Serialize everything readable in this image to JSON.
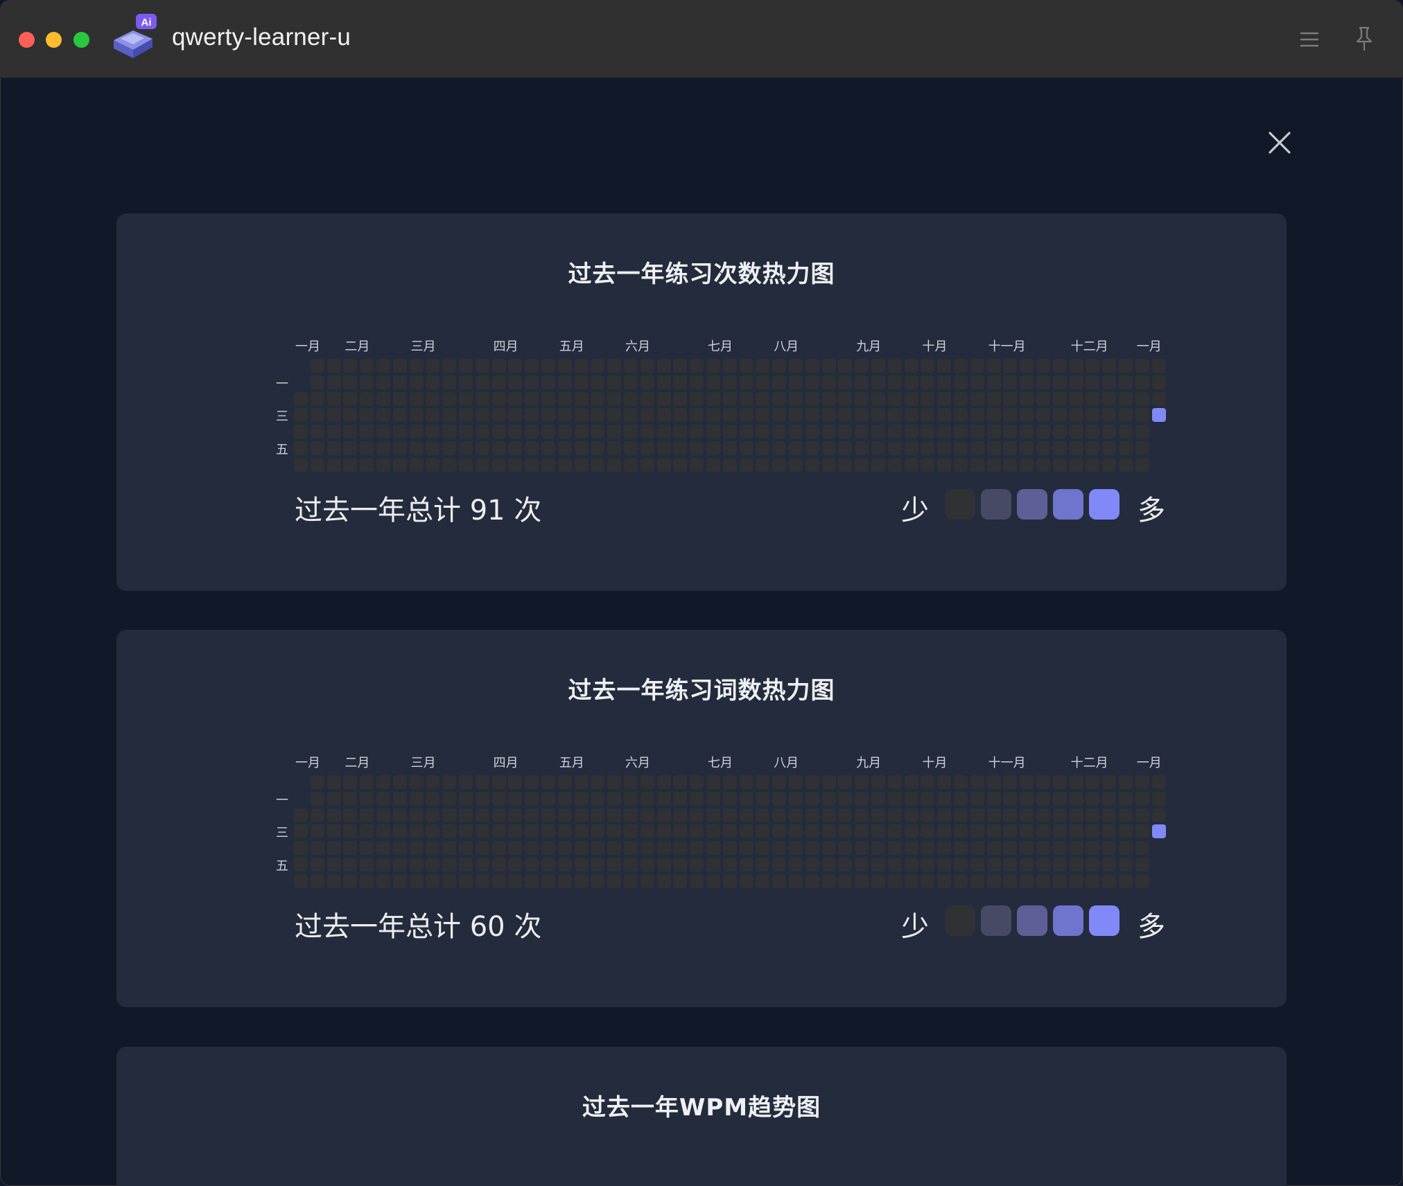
{
  "window": {
    "app_title": "qwerty-learner-u",
    "app_icon_badge": "Ai"
  },
  "heatmap_months": [
    "一月",
    "二月",
    "三月",
    "四月",
    "五月",
    "六月",
    "七月",
    "八月",
    "九月",
    "十月",
    "十一月",
    "十二月",
    "一月"
  ],
  "heatmap_days": [
    "一",
    "三",
    "五"
  ],
  "legend": {
    "less": "少",
    "more": "多",
    "colors": [
      "#2f3134",
      "#464a64",
      "#5e5f96",
      "#6f74cc",
      "#8089f7"
    ]
  },
  "cards": [
    {
      "title": "过去一年练习次数热力图",
      "total": "过去一年总计 91 次"
    },
    {
      "title": "过去一年练习词数热力图",
      "total": "过去一年总计 60 次"
    },
    {
      "title": "过去一年WPM趋势图"
    }
  ],
  "chart_data": [
    {
      "type": "heatmap",
      "title": "过去一年练习次数热力图",
      "x_labels": [
        "一月",
        "二月",
        "三月",
        "四月",
        "五月",
        "六月",
        "七月",
        "八月",
        "九月",
        "十月",
        "十一月",
        "十二月",
        "一月"
      ],
      "y_labels": [
        "一",
        "三",
        "五"
      ],
      "weeks": 53,
      "active_cells": [
        {
          "week": 52,
          "weekday": 3,
          "level": 4
        }
      ],
      "total": 91
    },
    {
      "type": "heatmap",
      "title": "过去一年练习词数热力图",
      "x_labels": [
        "一月",
        "二月",
        "三月",
        "四月",
        "五月",
        "六月",
        "七月",
        "八月",
        "九月",
        "十月",
        "十一月",
        "十二月",
        "一月"
      ],
      "y_labels": [
        "一",
        "三",
        "五"
      ],
      "weeks": 53,
      "active_cells": [
        {
          "week": 52,
          "weekday": 3,
          "level": 4
        }
      ],
      "total": 60
    }
  ]
}
